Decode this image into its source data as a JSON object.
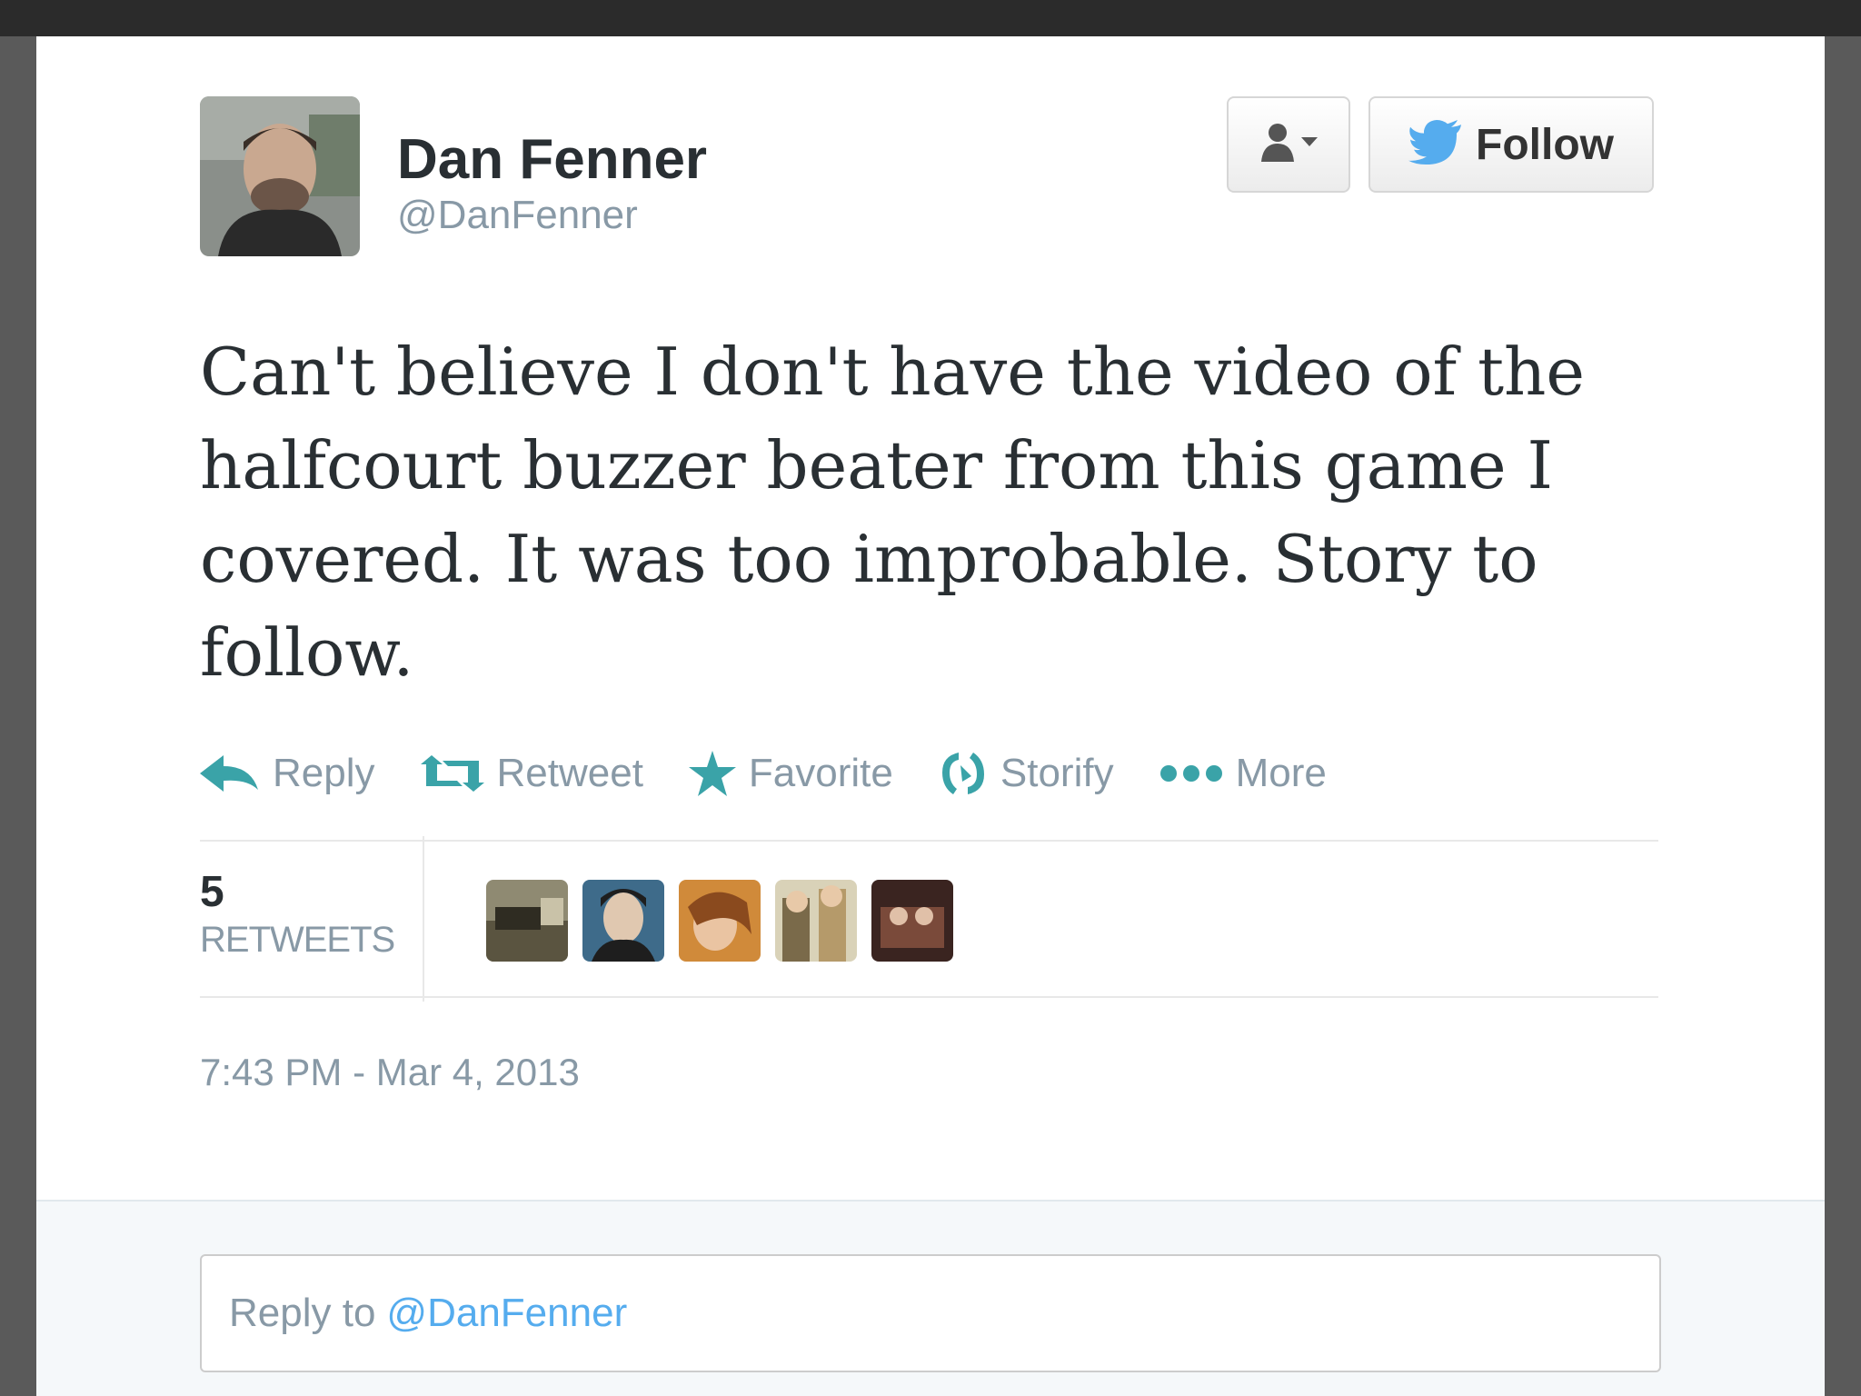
{
  "user": {
    "display_name": "Dan Fenner",
    "handle": "@DanFenner"
  },
  "header": {
    "follow_label": "Follow"
  },
  "tweet": {
    "text": "Can't believe I don't have the video of the halfcourt buzzer beater from this game I covered. It was too improbable. Story to follow."
  },
  "actions": [
    {
      "label": "Reply",
      "icon": "reply-icon"
    },
    {
      "label": "Retweet",
      "icon": "retweet-icon"
    },
    {
      "label": "Favorite",
      "icon": "star-icon"
    },
    {
      "label": "Storify",
      "icon": "storify-icon"
    },
    {
      "label": "More",
      "icon": "more-dots-icon"
    }
  ],
  "stats": {
    "retweet_count": "5",
    "retweet_label": "RETWEETS"
  },
  "timestamp": "7:43 PM - Mar 4, 2013",
  "reply": {
    "prefix": "Reply to",
    "handle": "@DanFenner"
  },
  "colors": {
    "action_teal": "#3aa3a8",
    "twitter_blue": "#55acee",
    "muted_text": "#8899a6",
    "text": "#292f33"
  }
}
